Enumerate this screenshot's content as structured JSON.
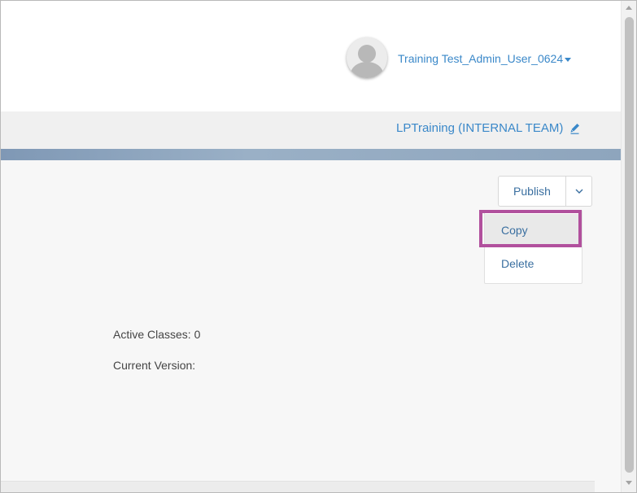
{
  "header": {
    "user_name": "Training Test_Admin_User_0624"
  },
  "org_bar": {
    "org_name": "LPTraining (INTERNAL TEAM)"
  },
  "actions": {
    "publish_label": "Publish",
    "menu_items": [
      {
        "label": "Copy"
      },
      {
        "label": "Delete"
      }
    ]
  },
  "details": {
    "active_classes": "Active Classes: 0",
    "current_version": "Current Version:"
  },
  "colors": {
    "link": "#3a88c9",
    "highlight": "#b1509d",
    "accent_band": "#8ea5bd"
  }
}
